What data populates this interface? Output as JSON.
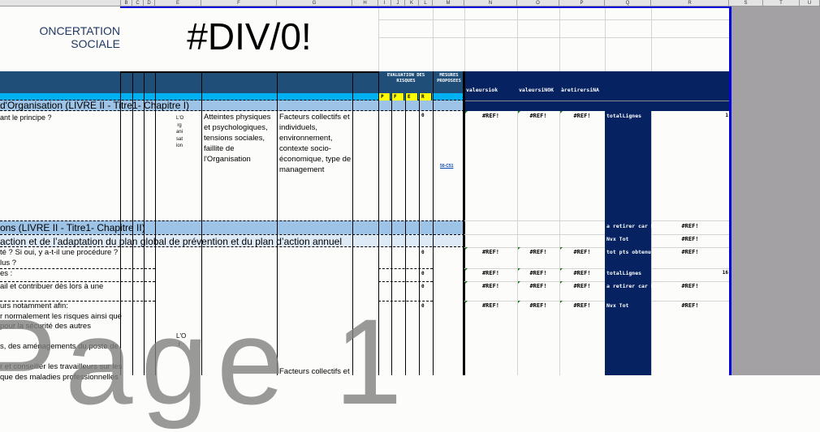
{
  "columns": [
    "B",
    "C",
    "D",
    "E",
    "F",
    "G",
    "H",
    "I",
    "J",
    "K",
    "L",
    "M",
    "N",
    "O",
    "P",
    "Q",
    "R",
    "S",
    "T",
    "U"
  ],
  "title_left": "ONCERTATION SOCIALE",
  "title_value": "#DIV/0!",
  "header": {
    "evaluation": "EVALUATION DES RISQUES",
    "mesures": "MESURES PROPOSEES",
    "risk_cols": [
      "P",
      "F",
      "E",
      "R"
    ],
    "n": "valeursiok",
    "o": "valeursiNOK",
    "p": "àretirersiNA"
  },
  "sections": {
    "s1": "d'Organisation (LIVRE II - Titre1- Chapitre I)",
    "s2": "ons  (LIVRE II - Titre1- Chapitre II)",
    "s3": "action et de l’adaptation du  plan global de prévention et du plan d’action annuel"
  },
  "row1": {
    "question": "ant le principe ?",
    "e_vertical": "L'Organisation",
    "f": "Atteintes physiques et psychologiques, tensions sociales, faillite de l'Organisation",
    "g": "Facteurs collectifs et individuels, environnement, contexte socio-économique, type de management",
    "l": "0",
    "link": "50-C51"
  },
  "rows": [
    {
      "q": "té ? Si oui, y a-t-il une procédure ?\nlus ?",
      "l": "0"
    },
    {
      "q": "es :",
      "l": "0"
    },
    {
      "q": "ail et contribuer dès lors à une",
      "l": "0"
    },
    {
      "q": "urs notamment afin:\nr normalement les risques ainsi que\npour la sécurité des autres\n\ns, des aménagements du poste de\n\nr et conseiller les travailleurs sur les\nque des maladies professionnelles",
      "l": "0"
    }
  ],
  "row_e_last": "L'Or",
  "row_g_last": "Facteurs collectifs et",
  "ref": "#REF!",
  "summary": [
    {
      "label": "totalLignes",
      "value": "1"
    },
    {
      "label": "a retirer car NA",
      "value": "#REF!"
    },
    {
      "label": "Nvx Tot",
      "value": "#REF!"
    },
    {
      "label": "tot pts obtenu",
      "value": "#REF!"
    },
    {
      "label": "totalLignes",
      "value": "16"
    },
    {
      "label": "a retirer car NA",
      "value": "#REF!"
    },
    {
      "label": "Nvx Tot",
      "value": "#REF!"
    }
  ],
  "watermark": "Page 1",
  "colors": {
    "header": "#1f4e79",
    "navy": "#062260",
    "cyan": "#00b0f0",
    "section": "#9dc3e6",
    "subsection": "#deebf7",
    "risk": "#ffff00",
    "pagebreak": "#0000e0"
  }
}
